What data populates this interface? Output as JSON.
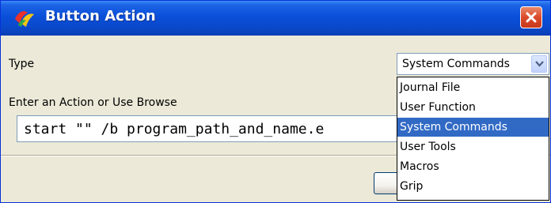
{
  "window": {
    "title": "Button Action",
    "close_icon": "close-icon",
    "app_icon": "app-logo-icon"
  },
  "form": {
    "type_label": "Type",
    "action_label": "Enter an Action or Use Browse",
    "action_value": "start \"\" /b program_path_and_name.e"
  },
  "type_select": {
    "selected": "System Commands",
    "arrow_icon": "chevron-down-icon",
    "options": [
      "Journal File",
      "User Function",
      "System Commands",
      "User Tools",
      "Macros",
      "Grip"
    ],
    "highlighted_index": 2
  },
  "colors": {
    "titlebar": "#0a4fd9",
    "highlight": "#316ac5",
    "window_bg": "#ece9d8"
  }
}
